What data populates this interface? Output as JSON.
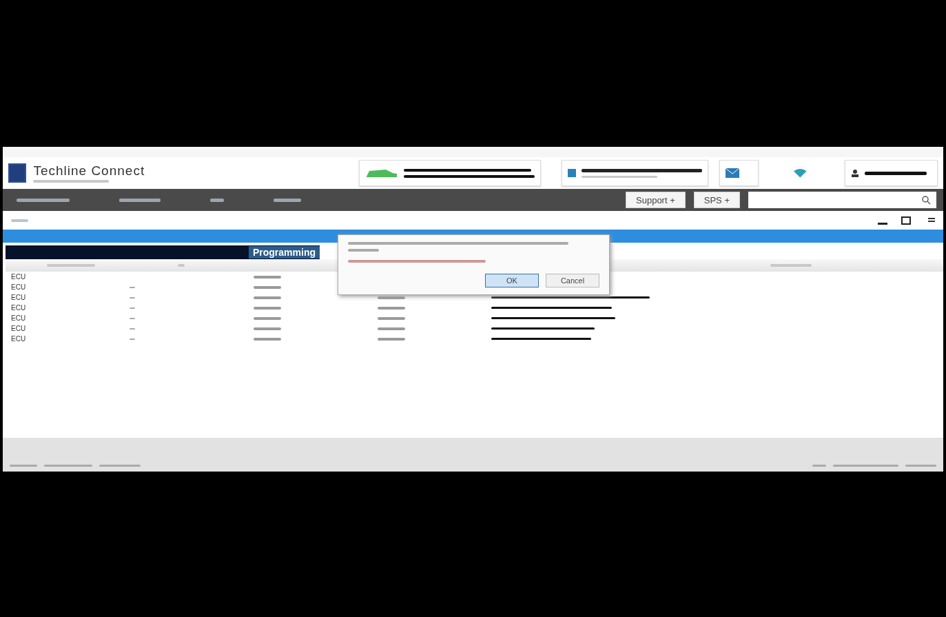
{
  "header": {
    "app_title": "Techline Connect"
  },
  "toolbar": {
    "buttons": [
      {
        "label": "Support +"
      },
      {
        "label": "SPS +"
      }
    ]
  },
  "table": {
    "title": "Programming",
    "rows": [
      {
        "column_1": "ECU"
      },
      {
        "column_1": "ECU"
      },
      {
        "column_1": "ECU"
      },
      {
        "column_1": "ECU"
      },
      {
        "column_1": "ECU"
      },
      {
        "column_1": "ECU"
      },
      {
        "column_1": "ECU"
      }
    ]
  },
  "dialog": {
    "buttons": [
      {
        "label": "OK",
        "selected": true
      },
      {
        "label": "Cancel",
        "selected": false
      }
    ]
  }
}
